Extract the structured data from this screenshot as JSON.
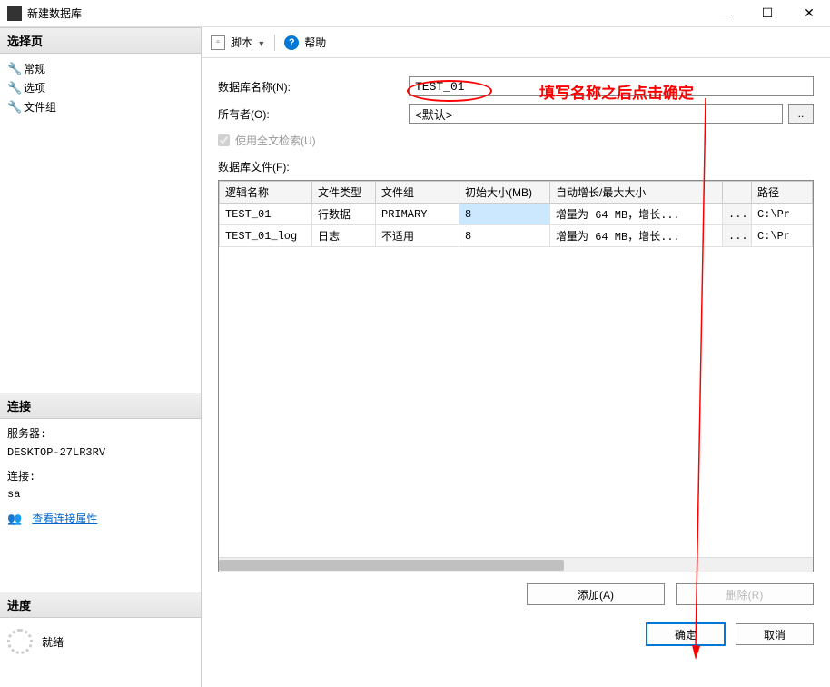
{
  "window": {
    "title": "新建数据库",
    "minimize": "—",
    "maximize": "☐",
    "close": "✕"
  },
  "sidebar": {
    "select_page_header": "选择页",
    "pages": [
      "常规",
      "选项",
      "文件组"
    ],
    "connection_header": "连接",
    "server_label": "服务器:",
    "server_value": "DESKTOP-27LR3RV",
    "connection_label": "连接:",
    "connection_value": "sa",
    "view_props_link": "查看连接属性",
    "progress_header": "进度",
    "progress_status": "就绪"
  },
  "toolbar": {
    "script_label": "脚本",
    "help_label": "帮助"
  },
  "form": {
    "db_name_label": "数据库名称(N):",
    "db_name_value": "TEST_01",
    "owner_label": "所有者(O):",
    "owner_value": "<默认>",
    "browse_btn": "..",
    "fulltext_label": "使用全文检索(U)"
  },
  "files": {
    "section_label": "数据库文件(F):",
    "columns": [
      "逻辑名称",
      "文件类型",
      "文件组",
      "初始大小(MB)",
      "自动增长/最大大小",
      "",
      "路径"
    ],
    "rows": [
      {
        "name": "TEST_01",
        "type": "行数据",
        "group": "PRIMARY",
        "size": "8",
        "growth": "增量为 64 MB，增长...",
        "btn": "...",
        "path": "C:\\Pr"
      },
      {
        "name": "TEST_01_log",
        "type": "日志",
        "group": "不适用",
        "size": "8",
        "growth": "增量为 64 MB，增长...",
        "btn": "...",
        "path": "C:\\Pr"
      }
    ]
  },
  "buttons": {
    "add": "添加(A)",
    "remove": "删除(R)",
    "ok": "确定",
    "cancel": "取消"
  },
  "annotation": {
    "text": "填写名称之后点击确定"
  }
}
